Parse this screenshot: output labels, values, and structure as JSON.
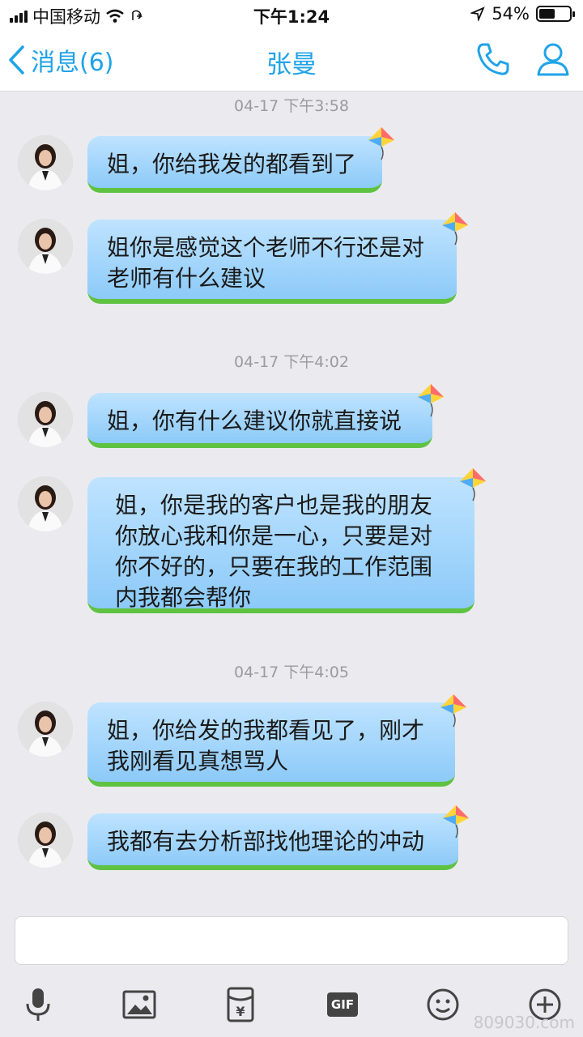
{
  "status_bar": {
    "carrier": "中国移动",
    "time": "下午1:24",
    "battery_percent": "54%",
    "battery_level": 0.54
  },
  "nav": {
    "back_label": "消息(6)",
    "title": "张曼",
    "accent_color": "#1fa3e8"
  },
  "timestamps": [
    "04-17 下午3:58",
    "04-17 下午4:02",
    "04-17 下午4:05"
  ],
  "messages": [
    {
      "text": "姐，你给我发的都看到了"
    },
    {
      "text": "姐你是感觉这个老师不行还是对\n老师有什么建议"
    },
    {
      "text": "姐，你有什么建议你就直接说"
    },
    {
      "text": "姐，你是我的客户也是我的朋友\n你放心我和你是一心，只要是对\n你不好的，只要在我的工作范围\n内我都会帮你"
    },
    {
      "text": "姐，你给发的我都看见了，刚才\n我刚看见真想骂人"
    },
    {
      "text": "我都有去分析部找他理论的冲动"
    }
  ],
  "toolbar": {
    "icons": [
      "microphone-icon",
      "image-icon",
      "red-envelope-icon",
      "gif-icon",
      "emoji-icon",
      "plus-icon"
    ],
    "gif_label": "GIF"
  },
  "watermark": "809030.com"
}
